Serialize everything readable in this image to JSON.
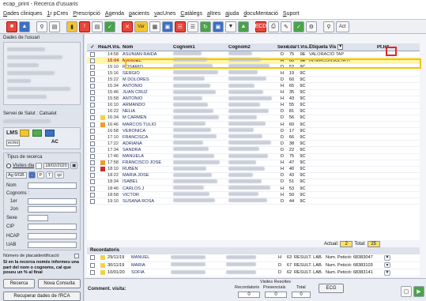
{
  "window": {
    "title": "ecap_print - Recerca d'usuaris"
  },
  "menu": [
    "Dades cliniques",
    "1r pCres",
    "Prescripció",
    "Agenda",
    "pacients",
    "vacUnes",
    "Catàlegs",
    "altres",
    "ajuda",
    "docuMentació",
    "Suport"
  ],
  "toolbar": {
    "labels": {
      "var": "Var",
      "ecd": "ECD",
      "act": "Act"
    }
  },
  "left_panel": {
    "user_data_title": "Dades de l'usuari",
    "servei_salut": "Servei de Salut : Catsalut",
    "lms": "LMS",
    "lms_badge": "ecmo",
    "ac": "AC",
    "tipus_recerca_title": "Tipus de recerca",
    "radio_visites": "Visites dia",
    "date_value": "18/02/2020",
    "ag_value": "Ag:9/GB",
    "ag_p": "P",
    "ag_t": "T",
    "ag_ipl": "ipl",
    "nom_label": "Nom",
    "cognoms_label": "Cognoms :",
    "first_label": "1er",
    "second_label": "2on",
    "sexe_label": "Sexe",
    "cip_label": "CIP",
    "hcap_label": "HCAP",
    "uab_label": "UAB",
    "placeidentificacio_label": "Número de placaidentificació",
    "warning_text": "Si en la recerca només informeu una part del nom o cognoms, cal que poseu un % al final",
    "buttons": {
      "recerca": "Recerca",
      "nova_consulta": "Nova Consulta",
      "recuperar": "Recuperar dades de l'RCA"
    }
  },
  "grid": {
    "headers": {
      "rea": "Rea.",
      "hora": "H.Vis.",
      "nom": "Nom",
      "cognom1": "Cognom1",
      "cognom2": "Cognom2",
      "sexe": "Sexe",
      "edat": "Edat",
      "tvis": "T.Vis.",
      "etiqueta": "Etiqueta Vis",
      "ptinf": "Pt.Inf."
    },
    "rows": [
      {
        "marker": "",
        "hora": "14:58",
        "nom": "ASUNIAN RAIDA",
        "sexe": "D",
        "edat": "75",
        "tvis": "9E",
        "etiqueta": "VALORACIÓ TAP",
        "selected": false
      },
      {
        "marker": "",
        "hora": "15:04",
        "nom": "MANUEL",
        "sexe": "H",
        "edat": "60",
        "tvis": "9E",
        "etiqueta": "INTERCONSULTA IT",
        "selected": true
      },
      {
        "marker": "",
        "hora": "15:10",
        "nom": "ROSARIO",
        "sexe": "D",
        "edat": "52",
        "tvis": "9C",
        "etiqueta": "",
        "selected": false
      },
      {
        "marker": "",
        "hora": "15:16",
        "nom": "SERGIO",
        "sexe": "H",
        "edat": "19",
        "tvis": "9C",
        "etiqueta": "",
        "selected": false
      },
      {
        "marker": "",
        "hora": "15:22",
        "nom": "M DOLORES",
        "sexe": "D",
        "edat": "60",
        "tvis": "9C",
        "etiqueta": "",
        "selected": false
      },
      {
        "marker": "",
        "hora": "15:34",
        "nom": "ANTONIO",
        "sexe": "H",
        "edat": "65",
        "tvis": "9C",
        "etiqueta": "",
        "selected": false
      },
      {
        "marker": "",
        "hora": "15:46",
        "nom": "JUAN CRUZ",
        "sexe": "H",
        "edat": "35",
        "tvis": "9C",
        "etiqueta": "",
        "selected": false
      },
      {
        "marker": "",
        "hora": "15:58",
        "nom": "ANTONIO",
        "sexe": "H",
        "edat": "43",
        "tvis": "9C",
        "etiqueta": "",
        "selected": false
      },
      {
        "marker": "",
        "hora": "16:10",
        "nom": "ARMANDO",
        "sexe": "H",
        "edat": "55",
        "tvis": "9C",
        "etiqueta": "",
        "selected": false
      },
      {
        "marker": "",
        "hora": "16:22",
        "nom": "NELIA",
        "sexe": "D",
        "edat": "81",
        "tvis": "9C",
        "etiqueta": "",
        "selected": false
      },
      {
        "marker": "yellow",
        "hora": "16:34",
        "nom": "M CARMEN",
        "sexe": "D",
        "edat": "56",
        "tvis": "9C",
        "etiqueta": "",
        "selected": false
      },
      {
        "marker": "orange",
        "hora": "16:46",
        "nom": "MARCOS TULIO",
        "sexe": "H",
        "edat": "60",
        "tvis": "9C",
        "etiqueta": "",
        "selected": false
      },
      {
        "marker": "",
        "hora": "16:58",
        "nom": "VERONICA",
        "sexe": "D",
        "edat": "17",
        "tvis": "9C",
        "etiqueta": "",
        "selected": false
      },
      {
        "marker": "",
        "hora": "17:10",
        "nom": "FRANCISCA",
        "sexe": "D",
        "edat": "66",
        "tvis": "9C",
        "etiqueta": "",
        "selected": false
      },
      {
        "marker": "",
        "hora": "17:22",
        "nom": "ADRIANA",
        "sexe": "D",
        "edat": "38",
        "tvis": "9C",
        "etiqueta": "",
        "selected": false
      },
      {
        "marker": "",
        "hora": "17:34",
        "nom": "SANDRA",
        "sexe": "D",
        "edat": "22",
        "tvis": "9C",
        "etiqueta": "",
        "selected": false
      },
      {
        "marker": "",
        "hora": "17:46",
        "nom": "MANUELA",
        "sexe": "D",
        "edat": "75",
        "tvis": "9C",
        "etiqueta": "",
        "selected": false
      },
      {
        "marker": "orange",
        "hora": "17:58",
        "nom": "FRANCISCO JOSE",
        "sexe": "H",
        "edat": "47",
        "tvis": "9C",
        "etiqueta": "",
        "selected": false
      },
      {
        "marker": "red",
        "hora": "18:10",
        "nom": "RUBEN",
        "sexe": "H",
        "edat": "40",
        "tvis": "9C",
        "etiqueta": "",
        "selected": false
      },
      {
        "marker": "",
        "hora": "18:22",
        "nom": "MARIA JOSE",
        "sexe": "D",
        "edat": "43",
        "tvis": "9C",
        "etiqueta": "",
        "selected": false
      },
      {
        "marker": "",
        "hora": "18:34",
        "nom": "ISABEL",
        "sexe": "D",
        "edat": "51",
        "tvis": "9C",
        "etiqueta": "",
        "selected": false
      },
      {
        "marker": "",
        "hora": "18:46",
        "nom": "CARLOS J",
        "sexe": "H",
        "edat": "53",
        "tvis": "9C",
        "etiqueta": "",
        "selected": false
      },
      {
        "marker": "",
        "hora": "18:58",
        "nom": "VICTOR",
        "sexe": "H",
        "edat": "50",
        "tvis": "9C",
        "etiqueta": "",
        "selected": false
      },
      {
        "marker": "",
        "hora": "19:10",
        "nom": "SUSANA ROSA",
        "sexe": "D",
        "edat": "44",
        "tvis": "9C",
        "etiqueta": "",
        "selected": false
      }
    ],
    "actual_label": "Actual:",
    "actual_value": "2",
    "total_label": "Total:",
    "total_value": "25"
  },
  "recordatoris": {
    "title": "Recordatoris",
    "rows": [
      {
        "date": "29/11/19",
        "nom": "MANUEL",
        "sexe": "H",
        "edat": "63",
        "result": "RESULT. LAB.",
        "peticio": "Num. Petició: 68383047"
      },
      {
        "date": "30/11/19",
        "nom": "MARIA",
        "sexe": "D",
        "edat": "67",
        "result": "RESULT. LAB.",
        "peticio": "Num. Petició: 68383103"
      },
      {
        "date": "10/01/20",
        "nom": "SOFIA",
        "sexe": "D",
        "edat": "62",
        "result": "RESULT. LAB.",
        "peticio": "Num. Petició: 68383141"
      }
    ]
  },
  "bottom": {
    "comment_label": "Comment. visita:",
    "visites_resoltes": "Visites Resoltes",
    "recordatoris": "Recordatoris",
    "presencials": "Presencials",
    "total": "Total",
    "val1": "0",
    "val2": "0",
    "val3": "0",
    "ecg": "ECG"
  }
}
